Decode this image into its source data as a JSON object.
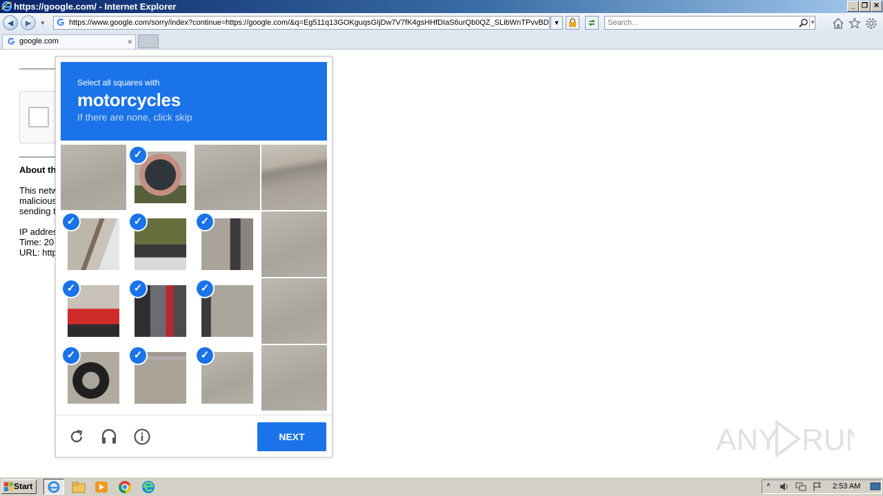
{
  "window": {
    "title": "https://google.com/ - Internet Explorer",
    "buttons": {
      "minimize": "_",
      "restore": "❐",
      "close": "✕"
    }
  },
  "navbar": {
    "address": "https://www.google.com/sorry/index?continue=https://google.com/&q=Eg511q13GOKguqsGIjDw7V7fK4gsHHfDIaS6urQb0QZ_SLibWnTPvvBDwB",
    "search_placeholder": "Search...",
    "icons": [
      "back-icon",
      "forward-icon",
      "lock-icon",
      "refresh-icon",
      "home-icon",
      "favorites-star-icon",
      "settings-gear-icon"
    ]
  },
  "tabs": [
    {
      "label": "google.com",
      "close": "×"
    }
  ],
  "background_page": {
    "about_heading": "About th",
    "line1": "This netw",
    "line2": "malicious",
    "line3": "sending t",
    "ip": "IP addres",
    "time": "Time: 20",
    "url": "URL: http"
  },
  "captcha": {
    "instruction_small": "Select all squares with",
    "target_word": "motorcycles",
    "hint": "If there are none, click skip",
    "next_label": "NEXT",
    "accent_color": "#1a73e8",
    "tiles": [
      {
        "selected": false,
        "content": "pavement"
      },
      {
        "selected": true,
        "content": "helmeted-rider"
      },
      {
        "selected": false,
        "content": "pavement"
      },
      {
        "selected": false,
        "content": "curb"
      },
      {
        "selected": true,
        "content": "motorcycle-mirror"
      },
      {
        "selected": true,
        "content": "rider-on-motorcycle"
      },
      {
        "selected": true,
        "content": "motorcycle-rear"
      },
      {
        "selected": false,
        "content": "pavement"
      },
      {
        "selected": true,
        "content": "red-motorcycle-front"
      },
      {
        "selected": true,
        "content": "rider-legs-motorcycle"
      },
      {
        "selected": true,
        "content": "motorcycle-edge"
      },
      {
        "selected": false,
        "content": "pavement"
      },
      {
        "selected": true,
        "content": "motorcycle-wheel"
      },
      {
        "selected": true,
        "content": "pavement-shoe"
      },
      {
        "selected": true,
        "content": "pavement"
      },
      {
        "selected": false,
        "content": "pavement"
      }
    ],
    "footer_icons": [
      "reload-icon",
      "audio-headphones-icon",
      "info-icon"
    ]
  },
  "watermark": "ANY RUN",
  "taskbar": {
    "start_label": "Start",
    "apps": [
      "internet-explorer-icon",
      "file-explorer-icon",
      "media-player-icon",
      "chrome-icon",
      "edge-icon"
    ],
    "clock": "2:53 AM"
  }
}
